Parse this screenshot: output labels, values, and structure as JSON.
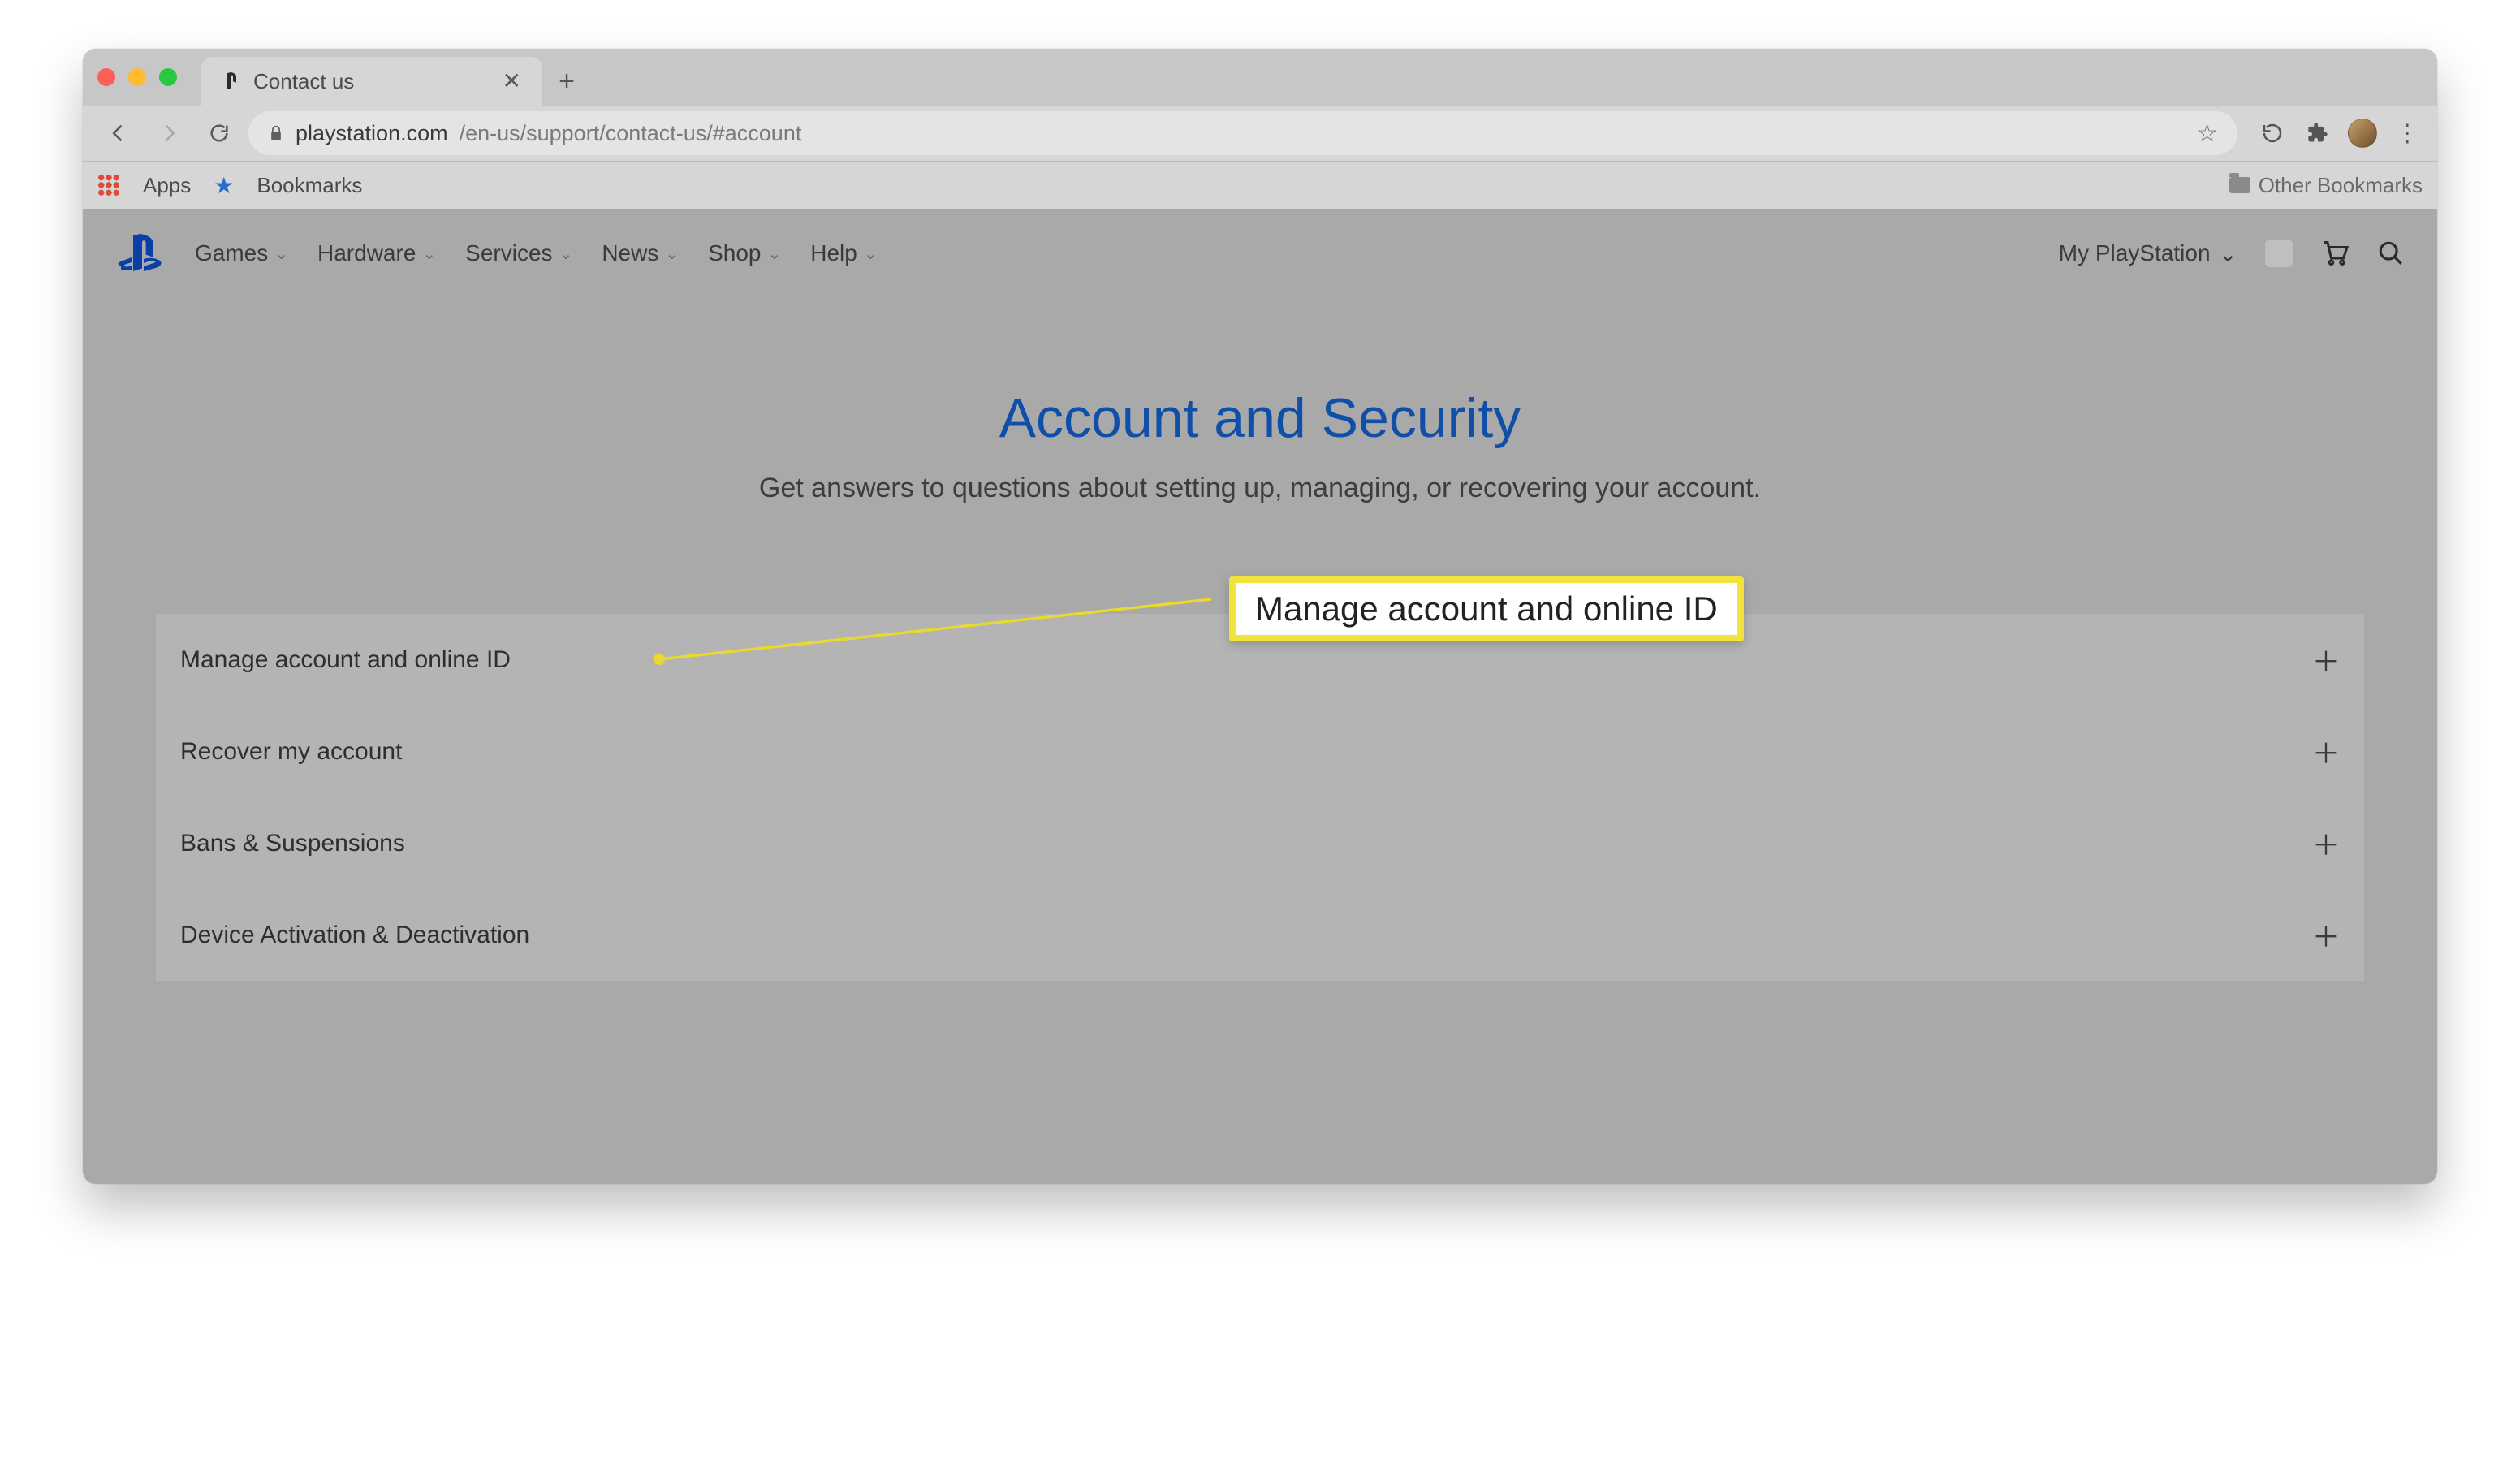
{
  "browser": {
    "tab_title": "Contact us",
    "url_domain": "playstation.com",
    "url_path": "/en-us/support/contact-us/#account",
    "apps_label": "Apps",
    "bookmarks_label": "Bookmarks",
    "other_bookmarks_label": "Other Bookmarks"
  },
  "nav": {
    "items": [
      "Games",
      "Hardware",
      "Services",
      "News",
      "Shop",
      "Help"
    ],
    "my_ps": "My PlayStation"
  },
  "hero": {
    "title": "Account and Security",
    "subtitle": "Get answers to questions about setting up, managing, or recovering your account."
  },
  "callout": {
    "text": "Manage account and online ID"
  },
  "accordion": {
    "items": [
      "Manage account and online ID",
      "Recover my account",
      "Bans & Suspensions",
      "Device Activation & Deactivation"
    ]
  }
}
